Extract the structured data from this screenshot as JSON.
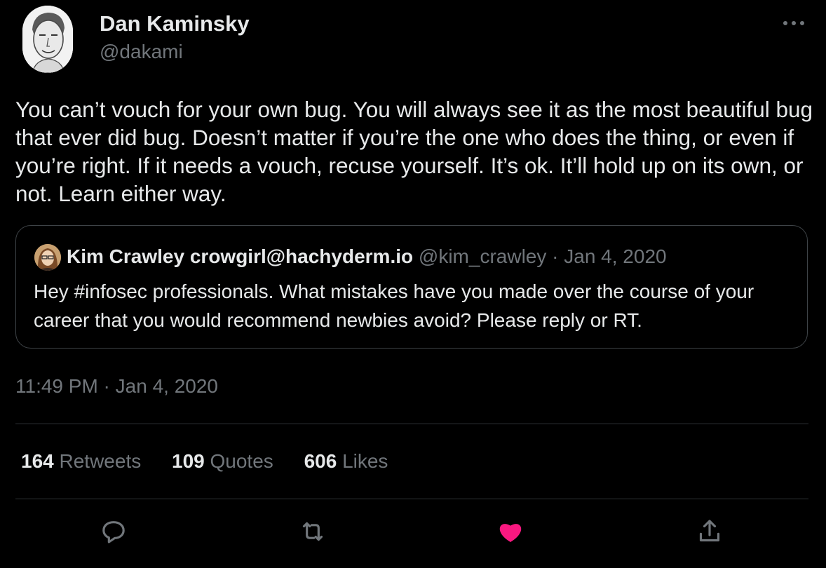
{
  "author": {
    "name": "Dan Kaminsky",
    "handle": "@dakami"
  },
  "tweet": {
    "text": "You can’t vouch for your own bug. You will always see it as the most beautiful bug that ever did bug. Doesn’t matter if you’re the one who does the thing, or even if you’re right. If it needs a vouch, recuse yourself. It’s ok.  It’ll hold up on its own, or not. Learn either way."
  },
  "quoted": {
    "name": "Kim Crawley crowgirl@hachyderm.io",
    "handle": "@kim_crawley",
    "separator": " · ",
    "date": "Jan 4, 2020",
    "text": "Hey #infosec professionals. What mistakes have you made over the course of your career that you would recommend newbies avoid? Please reply or RT."
  },
  "timestamp": "11:49 PM · Jan 4, 2020",
  "stats": {
    "retweets_count": "164",
    "retweets_label": "Retweets",
    "quotes_count": "109",
    "quotes_label": "Quotes",
    "likes_count": "606",
    "likes_label": "Likes"
  },
  "icons": {
    "more": "more-dots-icon",
    "reply": "reply-icon",
    "retweet": "retweet-icon",
    "like": "heart-icon-filled",
    "share": "share-icon"
  },
  "colors": {
    "background": "#000000",
    "text_primary": "#e7e9ea",
    "text_secondary": "#71767b",
    "border": "#2f3336",
    "like_active": "#f91880"
  }
}
